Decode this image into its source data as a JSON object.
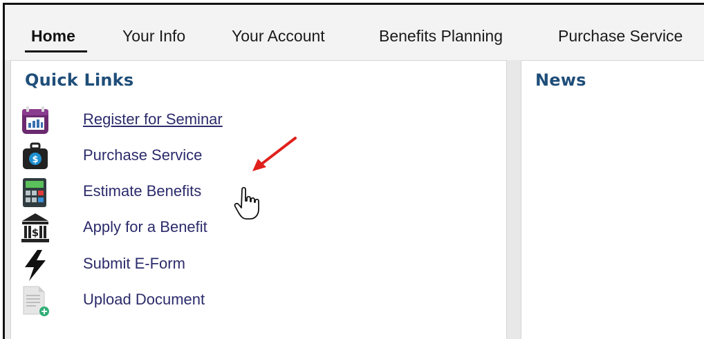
{
  "nav": {
    "tabs": [
      {
        "label": "Home",
        "active": true
      },
      {
        "label": "Your Info"
      },
      {
        "label": "Your Account"
      },
      {
        "label": "Benefits Planning"
      },
      {
        "label": "Purchase Service"
      }
    ]
  },
  "quick_links": {
    "title": "Quick Links",
    "items": [
      {
        "label": "Register for Seminar",
        "icon": "calendar-icon"
      },
      {
        "label": "Purchase Service",
        "icon": "money-bag-icon"
      },
      {
        "label": "Estimate Benefits",
        "icon": "calculator-icon"
      },
      {
        "label": "Apply for a Benefit",
        "icon": "bank-icon"
      },
      {
        "label": "Submit E-Form",
        "icon": "lightning-icon"
      },
      {
        "label": "Upload Document",
        "icon": "document-add-icon"
      }
    ]
  },
  "news": {
    "title": "News"
  },
  "colors": {
    "heading": "#1f4e79",
    "link": "#2b2b6b",
    "annotation_arrow": "#e0201b"
  }
}
